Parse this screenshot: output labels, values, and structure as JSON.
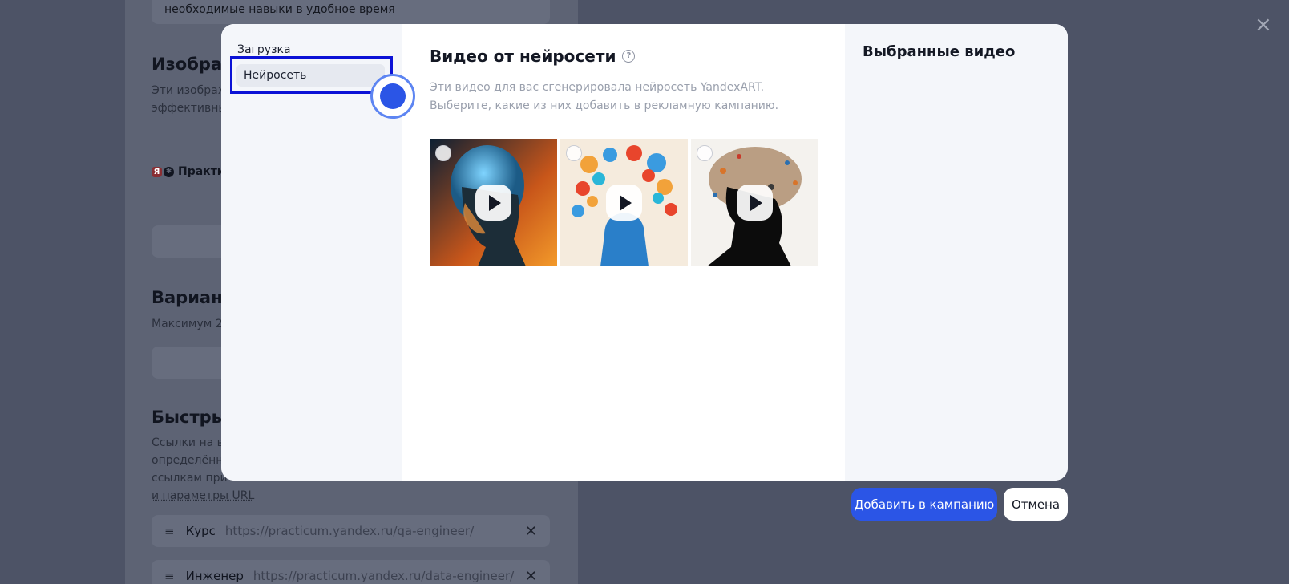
{
  "background": {
    "top_input_value": "необходимые навыки в удобное время",
    "section_images_heading": "Изображ",
    "section_images_text_1": "Эти изображ",
    "section_images_text_2": "эффективны",
    "brand_label": "Практи",
    "section_variants_heading": "Вариант",
    "section_variants_text": "Максимум 2",
    "section_quicklinks_heading": "Быстры",
    "section_quicklinks_text_1": "Ссылки на в",
    "section_quicklinks_text_2": "определённ",
    "section_quicklinks_text_3": "ссылкам при",
    "section_quicklinks_link": "и параметры URL",
    "links": [
      {
        "label": "Курс",
        "url": "https://practicum.yandex.ru/qa-engineer/"
      },
      {
        "label": "Инженер",
        "url": "https://practicum.yandex.ru/data-engineer/"
      }
    ]
  },
  "modal": {
    "nav": {
      "upload": "Загрузка",
      "neuro": "Нейросеть"
    },
    "title": "Видео от нейросети",
    "help_icon": "?",
    "description": "Эти видео для вас сгенерировала нейросеть YandexART. Выберите, какие из них добавить в рекламную кампанию.",
    "videos": [
      {
        "name": "video-1",
        "selected": false
      },
      {
        "name": "video-2",
        "selected": false
      },
      {
        "name": "video-3",
        "selected": false
      }
    ],
    "selected_title": "Выбранные видео"
  },
  "buttons": {
    "add": "Добавить в кампанию",
    "cancel": "Отмена"
  },
  "colors": {
    "accent": "#2b55e6",
    "highlight": "#0b12d6"
  }
}
